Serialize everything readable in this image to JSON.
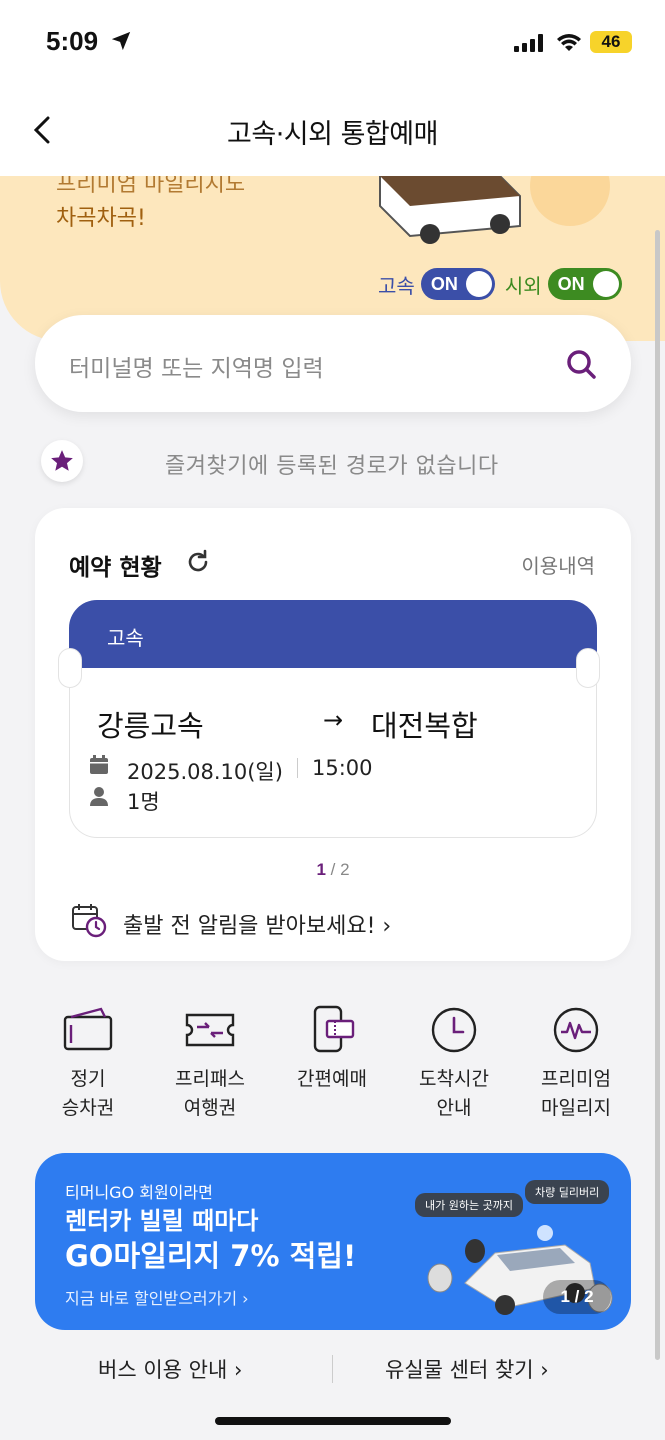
{
  "status_bar": {
    "time": "5:09",
    "battery": "46"
  },
  "header": {
    "title": "고속·시외 통합예매"
  },
  "banner": {
    "line1": "프리미엄 마일리지도",
    "line2": "차곡차곡!",
    "toggle_express_label": "고속",
    "toggle_express_state": "ON",
    "toggle_intercity_label": "시외",
    "toggle_intercity_state": "ON"
  },
  "search": {
    "placeholder": "터미널명 또는 지역명 입력"
  },
  "favorites": {
    "empty_text": "즐겨찾기에 등록된 경로가 없습니다"
  },
  "reservation": {
    "title": "예약 현황",
    "history_link": "이용내역",
    "ticket": {
      "type": "고속",
      "from": "강릉고속",
      "arrow": "→",
      "to": "대전복합",
      "date": "2025.08.10(일)",
      "time": "15:00",
      "passengers": "1명"
    },
    "pager_current": "1",
    "pager_total": "/ 2",
    "alarm_text": "출발 전 알림을 받아보세요! ›"
  },
  "quick_menu": [
    {
      "label": "정기\n승차권",
      "icon": "ticket-card-icon"
    },
    {
      "label": "프리패스\n여행권",
      "icon": "freepass-icon"
    },
    {
      "label": "간편예매",
      "icon": "phone-ticket-icon"
    },
    {
      "label": "도착시간\n안내",
      "icon": "clock-icon"
    },
    {
      "label": "프리미엄\n마일리지",
      "icon": "mileage-icon"
    }
  ],
  "promo": {
    "line1": "티머니GO 회원이라면",
    "line2": "렌터카 빌릴 때마다",
    "line3": "GO마일리지 7% 적립!",
    "cta": "지금 바로 할인받으러가기 ›",
    "bubble_a": "내가 원하는 곳까지",
    "bubble_b": "차량 딜리버리",
    "pager": "1 / 2"
  },
  "footer": {
    "bus_guide": "버스 이용 안내 ›",
    "lost_found": "유실물 센터 찾기 ›"
  },
  "colors": {
    "express": "#3b4fa8",
    "intercity": "#3d8b21",
    "accent_purple": "#6a1f7a",
    "promo_blue": "#2e7cf0",
    "banner_bg": "#fde7bd"
  }
}
